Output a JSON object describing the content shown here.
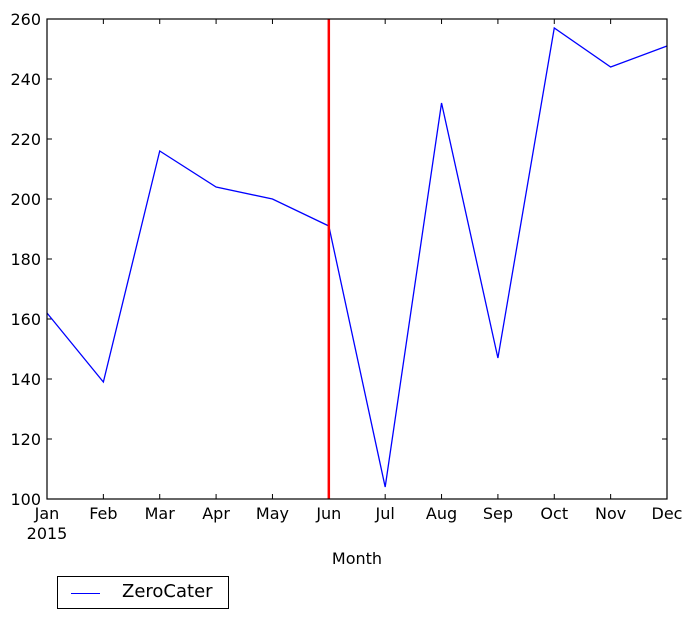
{
  "chart_data": {
    "type": "line",
    "title": "",
    "xlabel": "Month",
    "ylabel": "",
    "categories": [
      "Jan",
      "Feb",
      "Mar",
      "Apr",
      "May",
      "Jun",
      "Jul",
      "Aug",
      "Sep",
      "Oct",
      "Nov",
      "Dec"
    ],
    "x_sublabel": "2015",
    "series": [
      {
        "name": "ZeroCater",
        "color": "#0000ff",
        "values": [
          162,
          139,
          216,
          204,
          200,
          191,
          104,
          232,
          147,
          257,
          244,
          251
        ]
      }
    ],
    "ylim": [
      100,
      260
    ],
    "yticks": [
      100,
      120,
      140,
      160,
      180,
      200,
      220,
      240,
      260
    ],
    "vline": {
      "category": "Jun",
      "color": "#ff0000"
    },
    "grid": false,
    "legend_position": "below-left"
  }
}
